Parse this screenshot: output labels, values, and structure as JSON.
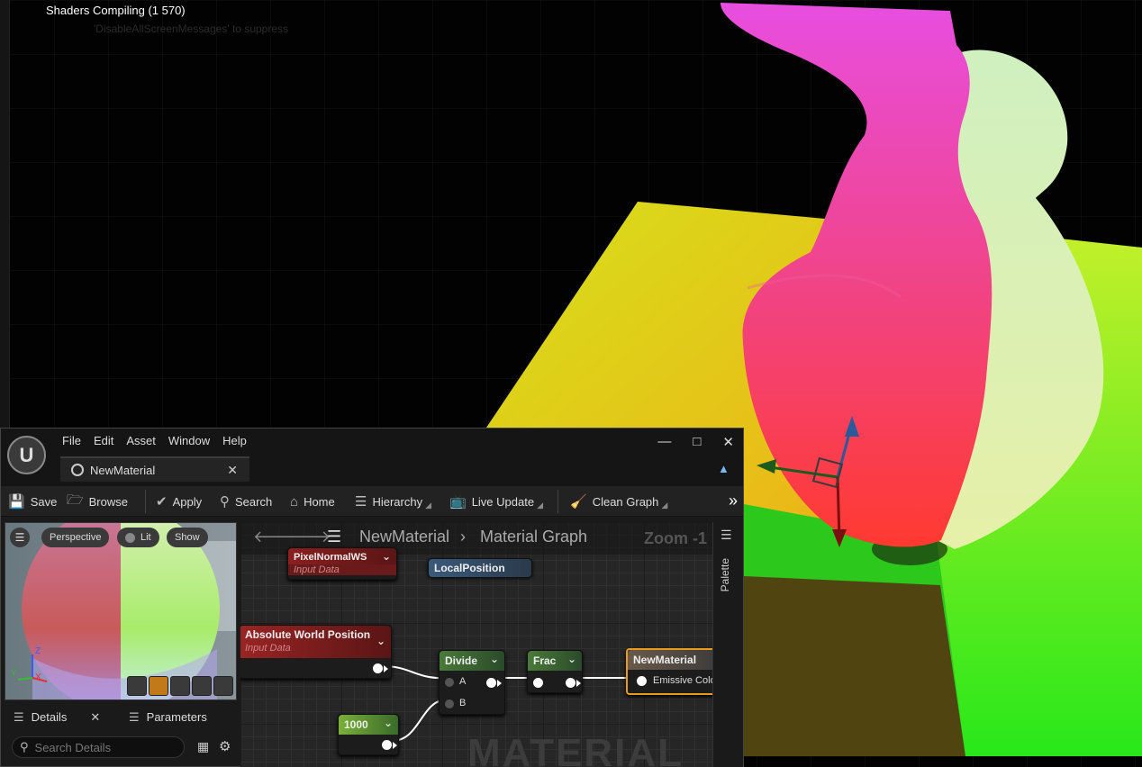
{
  "viewport": {
    "message": "Shaders Compiling (1 570)",
    "hint": "'DisableAllScreenMessages' to suppress"
  },
  "editor": {
    "menu": [
      "File",
      "Edit",
      "Asset",
      "Window",
      "Help"
    ],
    "tab_label": "NewMaterial",
    "toolbar": {
      "save": "Save",
      "browse": "Browse",
      "apply": "Apply",
      "search": "Search",
      "home": "Home",
      "hierarchy": "Hierarchy",
      "live_update": "Live Update",
      "clean_graph": "Clean Graph"
    },
    "preview": {
      "perspective": "Perspective",
      "lit": "Lit",
      "show": "Show",
      "axis_z": "Z",
      "axis_x": "X",
      "axis_y": "Y"
    },
    "details": {
      "details_tab": "Details",
      "parameters_tab": "Parameters",
      "search_placeholder": "Search Details"
    },
    "graph": {
      "breadcrumb_root": "NewMaterial",
      "breadcrumb_child": "Material Graph",
      "zoom": "Zoom -1",
      "watermark": "MATERIAL",
      "nodes": {
        "pixel_normal": {
          "title": "PixelNormalWS",
          "subtitle": "Input Data"
        },
        "local_position": {
          "title": "LocalPosition"
        },
        "abs_world_pos": {
          "title": "Absolute World Position",
          "subtitle": "Input Data"
        },
        "divide": {
          "title": "Divide",
          "pin_a": "A",
          "pin_b": "B"
        },
        "frac": {
          "title": "Frac"
        },
        "constant": {
          "title": "1000"
        },
        "output": {
          "title": "NewMaterial",
          "pin": "Emissive Color"
        }
      }
    },
    "palette_label": "Palette"
  }
}
